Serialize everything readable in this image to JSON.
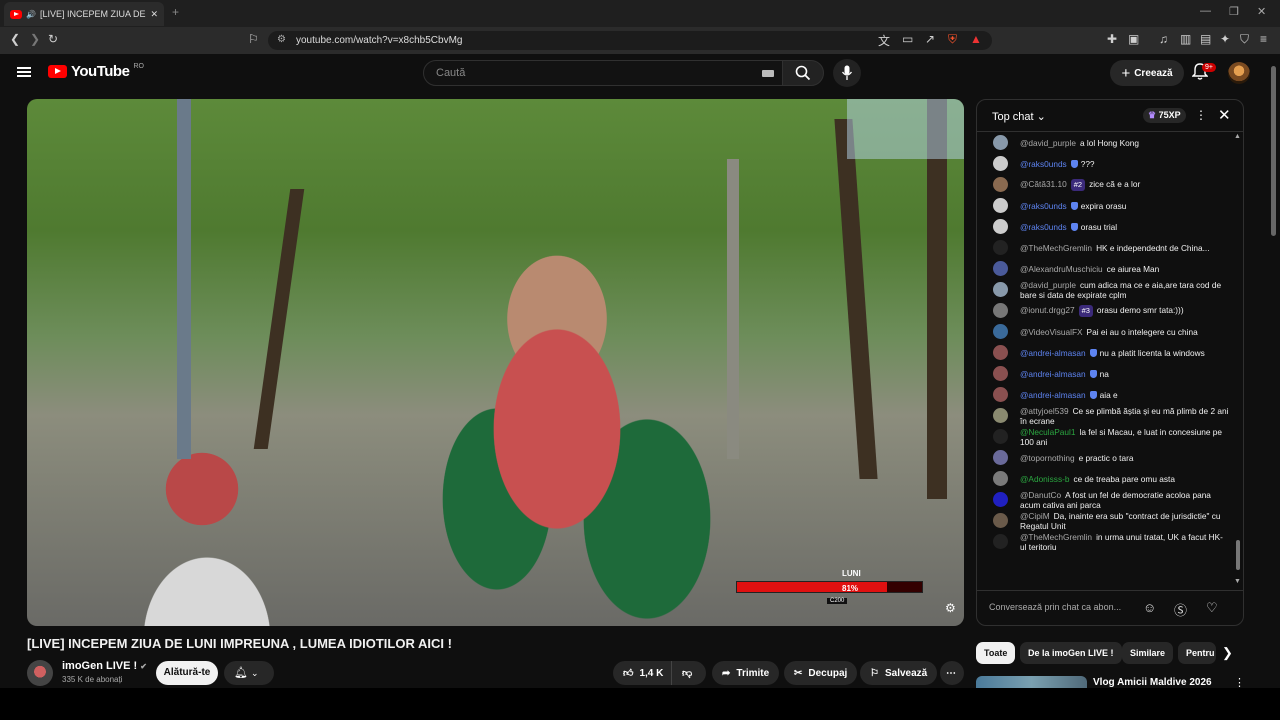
{
  "browser": {
    "tab_title": "[LIVE] INCEPEM ZIUA DE LUNI",
    "url": "youtube.com/watch?v=x8chb5CbvMg"
  },
  "header": {
    "logo_text": "YouTube",
    "logo_country": "RO",
    "search_placeholder": "Caută",
    "create_label": "Creează",
    "notifications_badge": "9+"
  },
  "video": {
    "overlay_label": "LUNI",
    "overlay_percent": "81%",
    "overlay_progress": 0.81,
    "overlay_sub": "C200",
    "title": "[LIVE] INCEPEM ZIUA DE LUNI IMPREUNA , LUMEA IDIOTILOR AICI !",
    "channel_name": "imoGen LIVE !",
    "subscribers": "335 K de abonați",
    "join_label": "Alătură-te",
    "likes": "1,4 K",
    "share_label": "Trimite",
    "clip_label": "Decupaj",
    "save_label": "Salvează"
  },
  "chat": {
    "title": "Top chat",
    "xp": "75XP",
    "input_placeholder": "Conversează prin chat ca abon...",
    "messages": [
      {
        "author": "@david_purple",
        "text": "a lol Hong Kong",
        "type": "normal",
        "color": "#8899aa"
      },
      {
        "author": "@raks0unds",
        "text": "???",
        "type": "mod",
        "color": "#cccccc"
      },
      {
        "author": "@Cătă31.10",
        "text": "zice că e a lor",
        "type": "normal",
        "rank": "#2",
        "color": "#8a6a50"
      },
      {
        "author": "@raks0unds",
        "text": "expira orasu",
        "type": "mod",
        "color": "#cccccc"
      },
      {
        "author": "@raks0unds",
        "text": "orasu trial",
        "type": "mod",
        "color": "#cccccc"
      },
      {
        "author": "@TheMechGremlin",
        "text": "HK e independednt de China...",
        "type": "normal",
        "color": "#222222"
      },
      {
        "author": "@AlexandruMuschiciu",
        "text": "ce aiurea Man",
        "type": "normal",
        "color": "#4a5a9a"
      },
      {
        "author": "@david_purple",
        "text": "cum adica ma ce e aia,are tara cod de bare si data de expirate cplm",
        "type": "normal",
        "color": "#8899aa"
      },
      {
        "author": "@ionut.drgg27",
        "text": "orasu demo smr tata:)))",
        "type": "normal",
        "rank": "#3",
        "color": "#777777"
      },
      {
        "author": "@VideoVisualFX",
        "text": "Pai ei au o intelegere cu china",
        "type": "normal",
        "color": "#3a6a9a"
      },
      {
        "author": "@andrei-almasan",
        "text": "nu a platit licenta la windows",
        "type": "mod",
        "color": "#8a5050"
      },
      {
        "author": "@andrei-almasan",
        "text": "na",
        "type": "mod",
        "color": "#8a5050"
      },
      {
        "author": "@andrei-almasan",
        "text": "aia e",
        "type": "mod",
        "color": "#8a5050"
      },
      {
        "author": "@attyjoel539",
        "text": "Ce se plimbă ăștia și eu mă plimb de 2 ani în ecrane",
        "type": "normal",
        "color": "#8a8a70"
      },
      {
        "author": "@NeculaPaul1",
        "text": "la fel si Macau, e luat in concesiune pe 100 ani",
        "type": "mem",
        "color": "#222222"
      },
      {
        "author": "@topornothing",
        "text": "e practic o tara",
        "type": "normal",
        "color": "#6a6a9a"
      },
      {
        "author": "@Adonisss-b",
        "text": "ce de treaba pare omu asta",
        "type": "mem",
        "color": "#7a7a7a"
      },
      {
        "author": "@DanutCo",
        "text": "A fost un fel de democratie acoloa pana acum cativa ani parca",
        "type": "normal",
        "color": "#2020c0"
      },
      {
        "author": "@CipiM",
        "text": "Da, inainte era sub \"contract de jurisdictie\" cu Regatul Unit",
        "type": "normal",
        "color": "#6a5a4a"
      },
      {
        "author": "@TheMechGremlin",
        "text": "in urma unui tratat, UK a facut HK-ul teritoriu",
        "type": "normal",
        "color": "#222222"
      }
    ]
  },
  "chips": [
    "Toate",
    "De la imoGen LIVE !",
    "Similare",
    "Pentru tine"
  ],
  "next_video": {
    "title": "Vlog Amicii Maldive 2026"
  },
  "colors": {
    "accent": "#ff0000",
    "mod_author": "#5e84f1",
    "member_author": "#2ba640"
  }
}
